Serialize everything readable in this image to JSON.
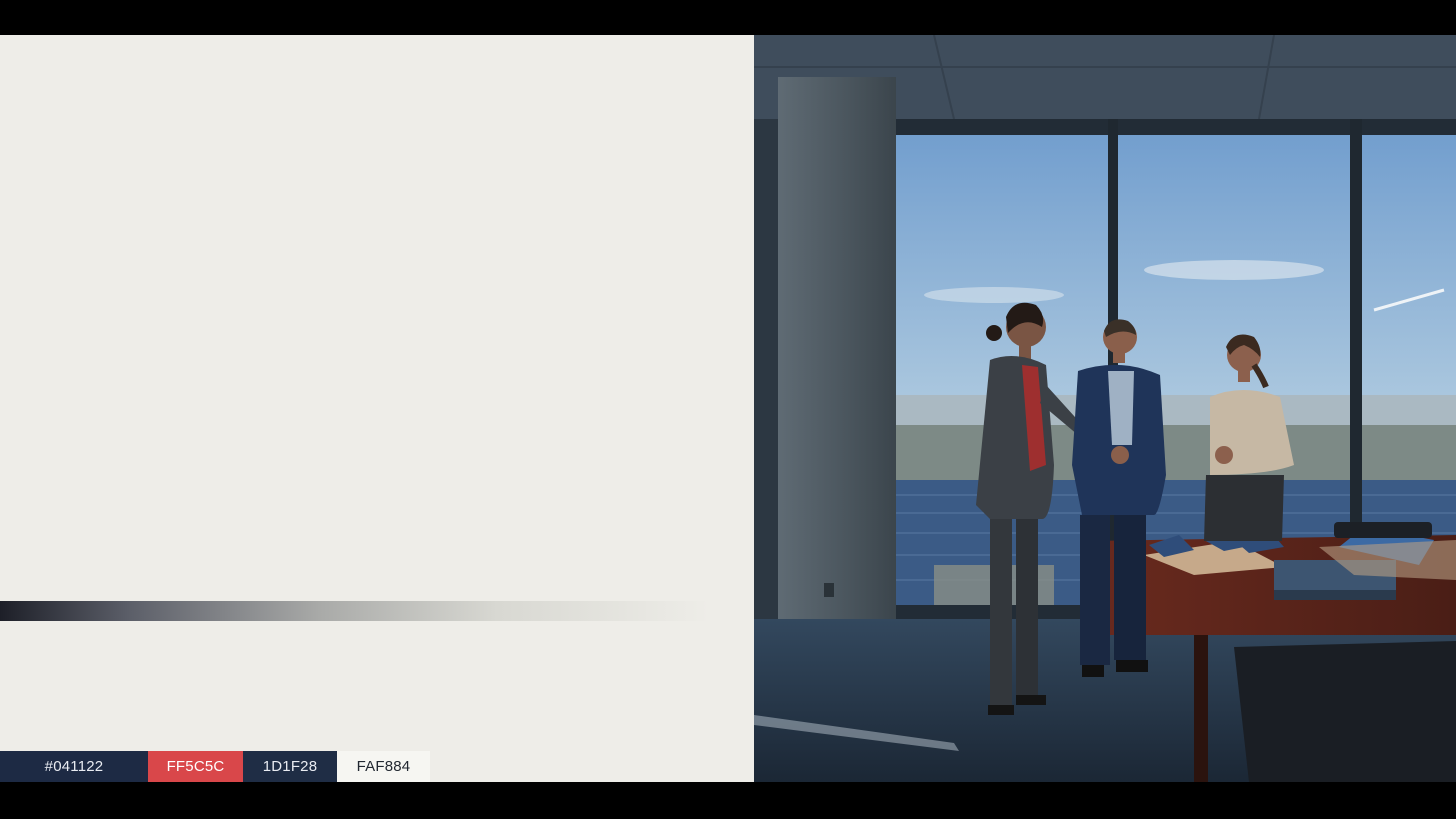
{
  "palette": {
    "swatches": [
      {
        "label": "#041122",
        "color": "#1d2a44"
      },
      {
        "label": "FF5C5C",
        "color": "#d9474a"
      },
      {
        "label": "1D1F28",
        "color": "#1f2d45"
      },
      {
        "label": "FAF884",
        "color": "#f6f6f2"
      }
    ]
  },
  "photo": {
    "subject": "office-meeting-photo"
  },
  "colors": {
    "panel_background": "#eeede8",
    "frame_background": "#000000"
  }
}
